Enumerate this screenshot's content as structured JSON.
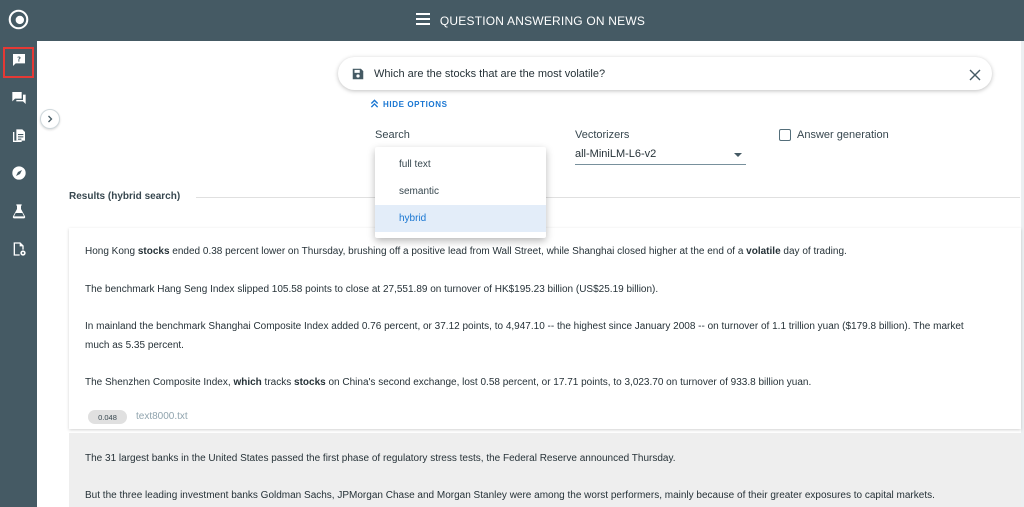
{
  "header": {
    "title": "QUESTION ANSWERING ON NEWS"
  },
  "colors": {
    "bar": "#455a64",
    "accent": "#1976d2",
    "active_outline": "#e53935"
  },
  "sidebar": {
    "items": [
      {
        "icon": "question-chat-icon",
        "active": true
      },
      {
        "icon": "forum-icon",
        "active": false
      },
      {
        "icon": "documents-icon",
        "active": false
      },
      {
        "icon": "compass-icon",
        "active": false
      },
      {
        "icon": "flask-icon",
        "active": false
      },
      {
        "icon": "file-settings-icon",
        "active": false
      }
    ]
  },
  "search": {
    "query": "Which are the stocks that are the most volatile?"
  },
  "options": {
    "hide_label": "HIDE OPTIONS",
    "search_label": "Search",
    "search_options": [
      "full text",
      "semantic",
      "hybrid"
    ],
    "search_selected": "hybrid",
    "vectorizers_label": "Vectorizers",
    "vectorizer_value": "all-MiniLM-L6-v2",
    "answer_generation_label": "Answer generation",
    "answer_generation_checked": false
  },
  "results": {
    "title": "Results (hybrid search)",
    "items": [
      {
        "paragraphs": [
          [
            {
              "t": "Hong Kong "
            },
            {
              "t": "stocks",
              "b": true
            },
            {
              "t": " ended 0.38 percent lower on Thursday, brushing off a positive lead from Wall Street, while Shanghai closed higher at the end of a "
            },
            {
              "t": "volatile",
              "b": true
            },
            {
              "t": " day of trading."
            }
          ],
          [
            {
              "t": "The benchmark Hang Seng Index slipped 105.58 points to close at 27,551.89 on turnover of HK$195.23 billion (US$25.19 billion)."
            }
          ],
          [
            {
              "t": "In mainland the benchmark Shanghai Composite Index added 0.76 percent, or 37.12 points, to 4,947.10 -- the highest since January 2008 -- on turnover of 1.1 trillion yuan ($179.8 billion). The market"
            }
          ],
          [
            {
              "t": "much as 5.35 percent."
            }
          ],
          [
            {
              "t": "The Shenzhen Composite Index, "
            },
            {
              "t": "which",
              "b": true
            },
            {
              "t": " tracks "
            },
            {
              "t": "stocks",
              "b": true
            },
            {
              "t": " on China's second exchange, lost 0.58 percent, or 17.71 points, to 3,023.70 on turnover of 933.8 billion yuan."
            }
          ]
        ],
        "score": "0.048",
        "file": "text8000.txt"
      },
      {
        "paragraphs": [
          [
            {
              "t": "The 31 largest banks in the United States passed the first phase of regulatory stress tests, the Federal Reserve announced Thursday."
            }
          ],
          [
            {
              "t": "But the three leading investment banks Goldman Sachs, JPMorgan Chase and Morgan Stanley were among the worst performers, mainly because of their greater exposures to capital markets."
            }
          ]
        ]
      }
    ]
  }
}
